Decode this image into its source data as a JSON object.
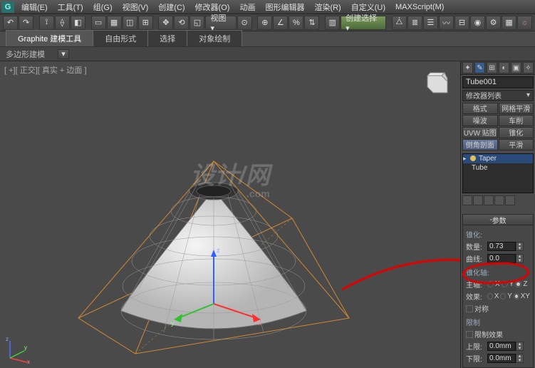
{
  "menu": [
    "编辑(E)",
    "工具(T)",
    "组(G)",
    "视图(V)",
    "创建(C)",
    "修改器(O)",
    "动画",
    "图形编辑器",
    "渲染(R)",
    "自定义(U)",
    "MAXScript(M)"
  ],
  "ribbon": {
    "tabs": [
      "Graphite 建模工具",
      "自由形式",
      "选择",
      "对象绘制"
    ],
    "row2_label": "多边形建模"
  },
  "viewport": {
    "label": "[ +][ 正交][ 真实 + 边面 ]",
    "watermark": "设计/网",
    "watermark_sub": ".com"
  },
  "panel": {
    "object_name": "Tube001",
    "dropdown": "修改器列表",
    "btns": [
      "格式",
      "网格平滑",
      "噪波",
      "车削",
      "UVW 贴图",
      "锥化",
      "倒角剖面",
      "平滑"
    ],
    "mods": [
      {
        "name": "Taper",
        "sel": true,
        "plus": true
      },
      {
        "name": "Tube",
        "sel": false,
        "plus": false
      }
    ],
    "roll_param_title": "参数",
    "taper": {
      "sec1_title": "锥化:",
      "amount_label": "数量:",
      "amount_value": "0.73",
      "curve_label": "曲线:",
      "curve_value": "0.0",
      "sec2_title": "锥化轴:",
      "primary_label": "主轴:",
      "effect_label": "效果:",
      "symmetry_label": "对称",
      "sec3_title": "限制",
      "limit_eff_label": "限制效果",
      "upper_label": "上限:",
      "upper_value": "0.0mm",
      "lower_label": "下限:",
      "lower_value": "0.0mm"
    }
  }
}
